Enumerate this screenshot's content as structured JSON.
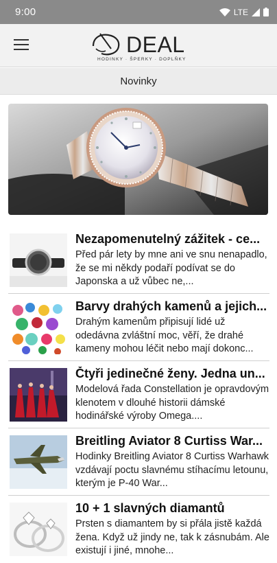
{
  "status": {
    "time": "9:00",
    "network": "LTE"
  },
  "header": {
    "logo_text": "DEAL",
    "logo_tagline": "HODINKY · ŠPERKY · DOPLŇKY"
  },
  "section": {
    "title": "Novinky"
  },
  "articles": [
    {
      "title": "Nezapomenutelný zážitek - ce...",
      "excerpt": "Před pár lety by mne ani ve snu nenapadlo, že se mi někdy podaří podívat se do Japonska a už vůbec ne,..."
    },
    {
      "title": "Barvy drahých kamenů a jejich...",
      "excerpt": "Drahým kamenům připisují lidé už odedávna zvláštní moc, věří, že drahé kameny mohou léčit nebo mají dokonc..."
    },
    {
      "title": "Čtyři jedinečné ženy. Jedna un...",
      "excerpt": "Modelová řada Constellation je opravdovým klenotem v dlouhé historii dámské hodinářské výroby Omega...."
    },
    {
      "title": "Breitling Aviator 8 Curtiss War...",
      "excerpt": "Hodinky Breitling Aviator 8 Curtiss Warhawk vzdávají poctu slavnému stíhacímu letounu, kterým je P-40 War..."
    },
    {
      "title": "10 + 1 slavných diamantů",
      "excerpt": "Prsten s diamantem by si přála jistě každá žena. Když už jindy ne, tak k zásnubám. Ale existují i jiné, mnohe..."
    }
  ]
}
